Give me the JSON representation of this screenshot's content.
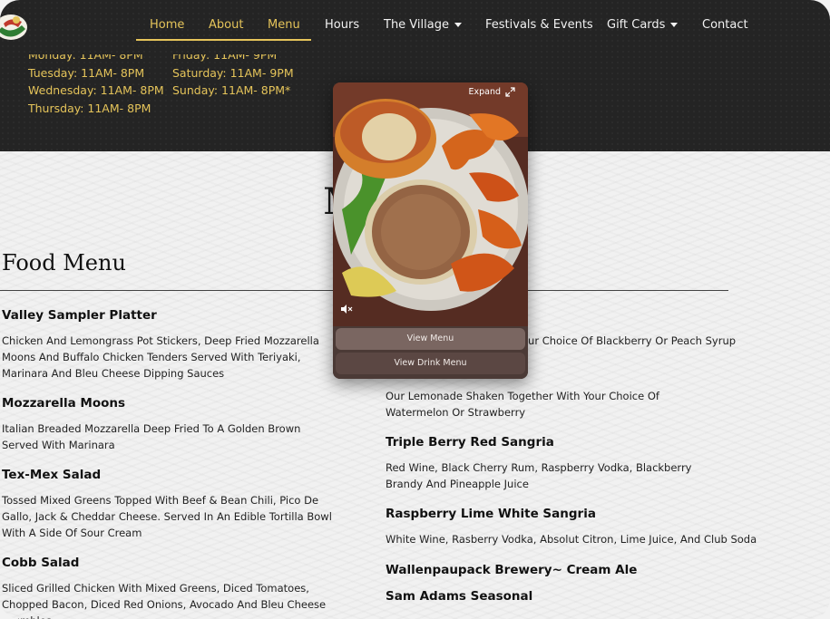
{
  "nav": {
    "items": [
      {
        "label": "Home",
        "active": true
      },
      {
        "label": "About",
        "active": true
      },
      {
        "label": "Menu",
        "active": true
      },
      {
        "label": "Hours",
        "active": false
      },
      {
        "label": "The Village",
        "active": false,
        "dropdown": true
      },
      {
        "label": "Festivals & Events",
        "active": false
      },
      {
        "label": "Gift Cards",
        "active": false,
        "dropdown": true
      },
      {
        "label": "Contact",
        "active": false
      }
    ]
  },
  "hours": {
    "left": [
      "Monday: 11AM- 8PM",
      "Tuesday: 11AM- 8PM",
      "Wednesday: 11AM- 8PM",
      "Thursday: 11AM- 8PM"
    ],
    "right": [
      "Friday: 11AM- 9PM",
      "Saturday: 11AM- 9PM",
      "Sunday: 11AM- 8PM*"
    ]
  },
  "page": {
    "heading_partial": "M",
    "section_title": "Food Menu"
  },
  "food": [
    {
      "name": "Valley Sampler Platter",
      "desc": "Chicken And Lemongrass Pot Stickers, Deep Fried Mozzarella Moons And Buffalo Chicken Tenders Served With Teriyaki, Marinara And Bleu Cheese Dipping Sauces"
    },
    {
      "name": "Mozzarella Moons",
      "desc": "Italian Breaded Mozzarella Deep Fried To A Golden Brown Served With Marinara"
    },
    {
      "name": "Tex-Mex Salad",
      "desc": "Tossed Mixed Greens Topped With Beef & Bean Chili, Pico De Gallo, Jack & Cheddar Cheese. Served In An Edible Tortilla Bowl With A Side Of Sour Cream"
    },
    {
      "name": "Cobb Salad",
      "desc": "Sliced Grilled Chicken With Mixed Greens, Diced Tomatoes, Chopped Bacon, Diced Red Onions, Avocado And Bleu Cheese Crumbles"
    }
  ],
  "drinks": {
    "partial_desc": "our Choice Of Blackberry Or Peach Syrup",
    "lemonade_desc": "Our Lemonade Shaken Together With Your Choice Of Watermelon Or Strawberry",
    "items": [
      {
        "name": "Triple Berry Red Sangria",
        "desc": "Red Wine, Black Cherry Rum, Raspberry Vodka, Blackberry Brandy And Pineapple Juice"
      },
      {
        "name": "Raspberry Lime White Sangria",
        "desc": "White Wine, Rasberry Vodka, Absolut Citron, Lime Juice, And Club Soda"
      },
      {
        "name": "Wallenpaupack Brewery~ Cream Ale",
        "desc": ""
      },
      {
        "name": "Sam Adams Seasonal",
        "desc": ""
      }
    ]
  },
  "popup": {
    "expand_label": "Expand",
    "view_menu": "View Menu",
    "view_drink_menu": "View Drink Menu",
    "icons": [
      "expand-icon",
      "mute-icon"
    ]
  },
  "colors": {
    "accent": "#e5c45a",
    "band": "#242424",
    "text": "#111111"
  }
}
